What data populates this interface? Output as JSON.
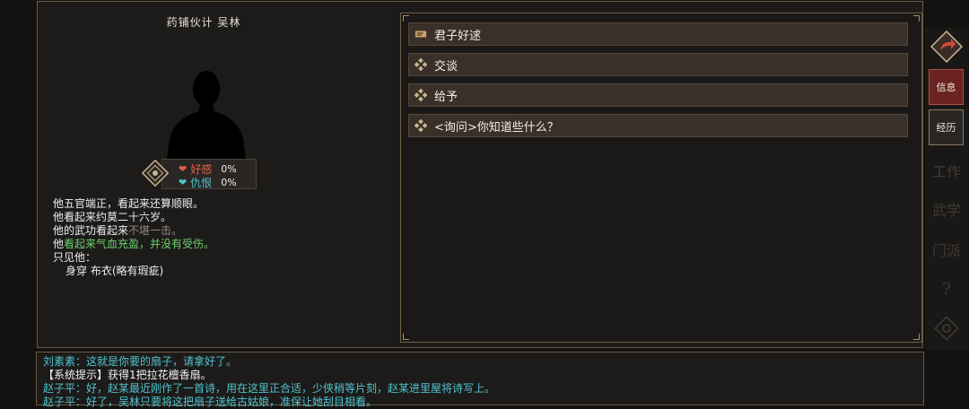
{
  "npc": {
    "title": "药铺伙计 吴林",
    "stats": [
      {
        "label": "好感",
        "value": "0%",
        "color": "#e0624a"
      },
      {
        "label": "仇恨",
        "value": "0%",
        "color": "#4fc3d2"
      }
    ]
  },
  "description": {
    "line1": "他五官端正，看起来还算顺眼。",
    "line2": "他看起来约莫二十六岁。",
    "line3_prefix": "他的武功看起来",
    "line3_grey": "不堪一击。",
    "line4_prefix": "他",
    "line4_green": "看起来气血充盈，并没有受伤。",
    "line5": "只见他：",
    "line6_label": "身穿",
    "line6_value": "布衣(略有瑕疵)"
  },
  "dialog_options": [
    {
      "label": "君子好逑",
      "icon": "scroll-icon"
    },
    {
      "label": "交谈",
      "icon": "diamond-icon"
    },
    {
      "label": "给予",
      "icon": "diamond-icon"
    },
    {
      "label": "<询问>你知道些什么？",
      "icon": "diamond-icon"
    }
  ],
  "sidebar": {
    "info_label": "信息",
    "history_label": "经历",
    "ghost1": "工作",
    "ghost2": "武学",
    "ghost3": "门派",
    "ghost4": "?"
  },
  "log": {
    "line1": "刘素素：这就是你要的扇子，请拿好了。",
    "line2": "【系统提示】获得1把拉花檀香扇。",
    "line3": "赵子平：好，赵某最近刚作了一首诗，用在这里正合适，少侠稍等片刻，赵某进里屋将诗写上。",
    "line4": "赵子平：好了，吴林只要将这把扇子送给古姑娘，准保让她刮目相看。"
  },
  "colors": {
    "panel_border": "#6b5a41",
    "option_bg": "#3a302a",
    "info_active": "#6a2321",
    "cyan_text": "#4fc3d2",
    "green_text": "#6cd06c"
  }
}
